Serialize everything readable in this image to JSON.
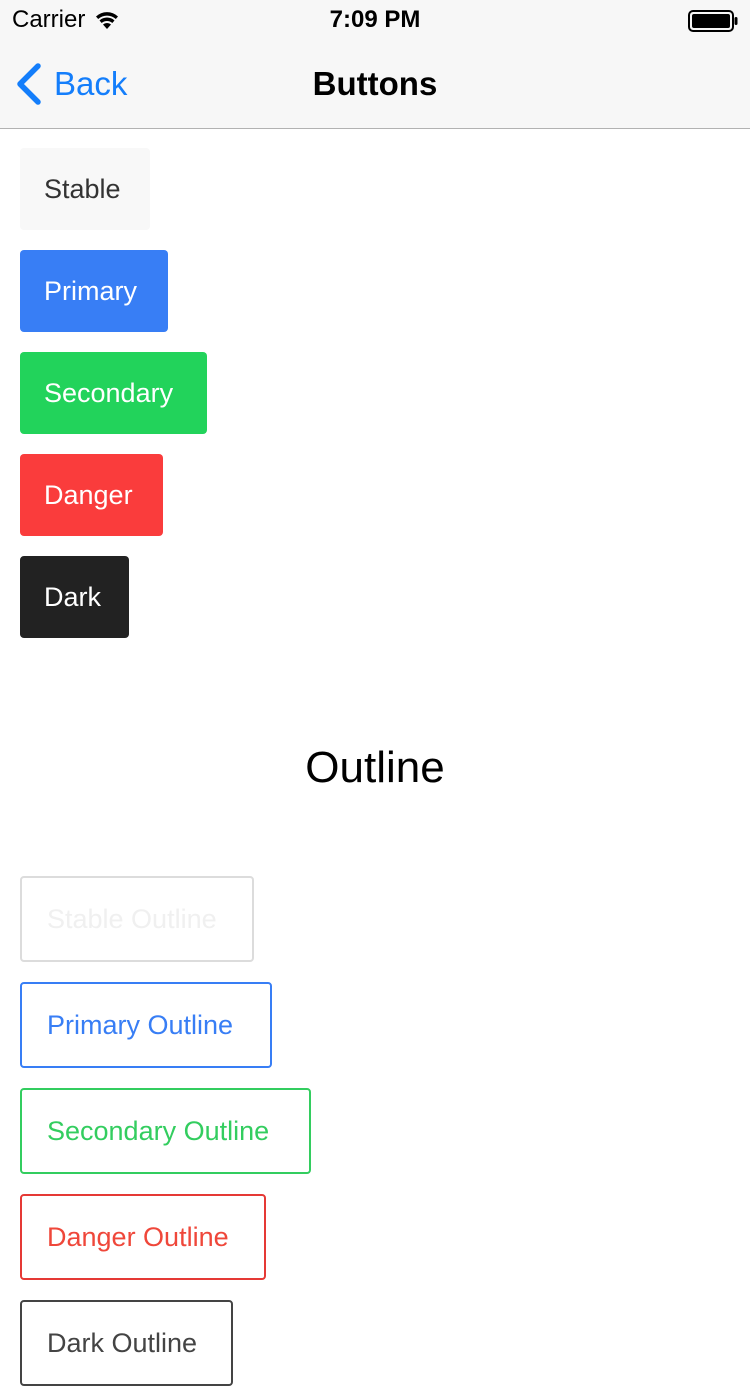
{
  "status_bar": {
    "carrier": "Carrier",
    "time": "7:09 PM",
    "wifi_icon": "wifi-icon",
    "battery_icon": "battery-icon"
  },
  "nav": {
    "back_label": "Back",
    "back_icon": "chevron-left-icon",
    "title": "Buttons",
    "accent_color": "#147efb"
  },
  "buttons": {
    "stable": "Stable",
    "primary": "Primary",
    "secondary": "Secondary",
    "danger": "Danger",
    "dark": "Dark"
  },
  "outline_section": {
    "title": "Outline",
    "buttons": {
      "stable": "Stable Outline",
      "primary": "Primary Outline",
      "secondary": "Secondary Outline",
      "danger": "Danger Outline",
      "dark": "Dark Outline"
    }
  },
  "colors": {
    "stable": "#f8f8f8",
    "primary": "#387ef5",
    "secondary": "#22d35b",
    "danger": "#fa3c3c",
    "dark": "#222222"
  }
}
